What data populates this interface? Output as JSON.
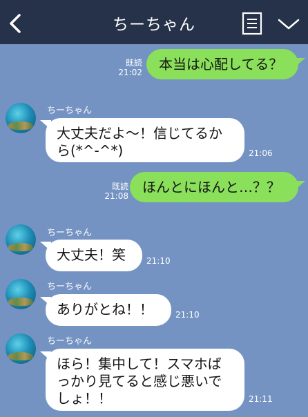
{
  "colors": {
    "background": "#7493c2",
    "header": "#263249",
    "outgoing_bubble": "#8ae05a",
    "incoming_bubble": "#ffffff"
  },
  "header": {
    "title": "ちーちゃん",
    "back_icon": "chevron-left-icon",
    "menu_icon": "note-list-icon",
    "collapse_icon": "chevron-down-icon"
  },
  "messages": [
    {
      "direction": "out",
      "text": "本当は心配してる？",
      "read": "既読",
      "time": "21:02"
    },
    {
      "direction": "in",
      "sender": "ちーちゃん",
      "lines": [
        "大丈夫だよ～！信じてるか",
        "ら(*^-^*)"
      ],
      "time": "21:06"
    },
    {
      "direction": "out",
      "text": "ほんとにほんと…？？",
      "read": "既読",
      "time": "21:08"
    },
    {
      "direction": "in",
      "sender": "ちーちゃん",
      "lines": [
        "大丈夫！笑"
      ],
      "time": "21:10"
    },
    {
      "direction": "in",
      "sender": "ちーちゃん",
      "lines": [
        "ありがとね！！"
      ],
      "time": "21:10"
    },
    {
      "direction": "in",
      "sender": "ちーちゃん",
      "lines": [
        "ほら！集中して！スマホば",
        "っかり見てると感じ悪いで",
        "しょ！！"
      ],
      "time": "21:11"
    }
  ]
}
